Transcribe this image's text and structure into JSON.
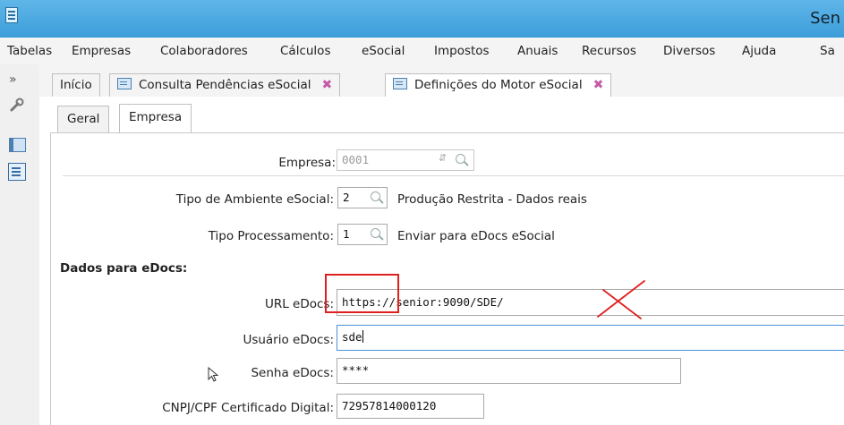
{
  "window": {
    "title": "Sen"
  },
  "menu": [
    "Tabelas",
    "Empresas",
    "Colaboradores",
    "Cálculos",
    "eSocial",
    "Impostos",
    "Anuais",
    "Recursos",
    "Diversos",
    "Ajuda",
    "Sa"
  ],
  "leftbar": {
    "chevron": "»"
  },
  "doc_tabs": [
    {
      "label": "Início"
    },
    {
      "label": "Consulta Pendências eSocial",
      "close": "✖"
    },
    {
      "label": "Definições do Motor eSocial",
      "close": "✖"
    }
  ],
  "sub_tabs": [
    "Geral",
    "Empresa"
  ],
  "form": {
    "empresa": {
      "label": "Empresa:",
      "value": "0001",
      "sort": "⇵"
    },
    "tipo_ambiente": {
      "label": "Tipo de Ambiente eSocial:",
      "value": "2",
      "description": "Produção Restrita - Dados reais"
    },
    "tipo_processamento": {
      "label": "Tipo Processamento:",
      "value": "1",
      "description": "Enviar para eDocs eSocial"
    },
    "section_title": "Dados para eDocs:",
    "url": {
      "label": "URL eDocs:",
      "value": "https://senior:9090/SDE/"
    },
    "usuario": {
      "label": "Usuário eDocs:",
      "value": "sde"
    },
    "senha": {
      "label": "Senha eDocs:",
      "value": "****"
    },
    "cnpj": {
      "label": "CNPJ/CPF Certificado Digital:",
      "value": "72957814000120"
    }
  },
  "colors": {
    "title_bar": "#3c9dda",
    "annotation_red": "#e02020",
    "close_icon": "#c55aa6"
  }
}
